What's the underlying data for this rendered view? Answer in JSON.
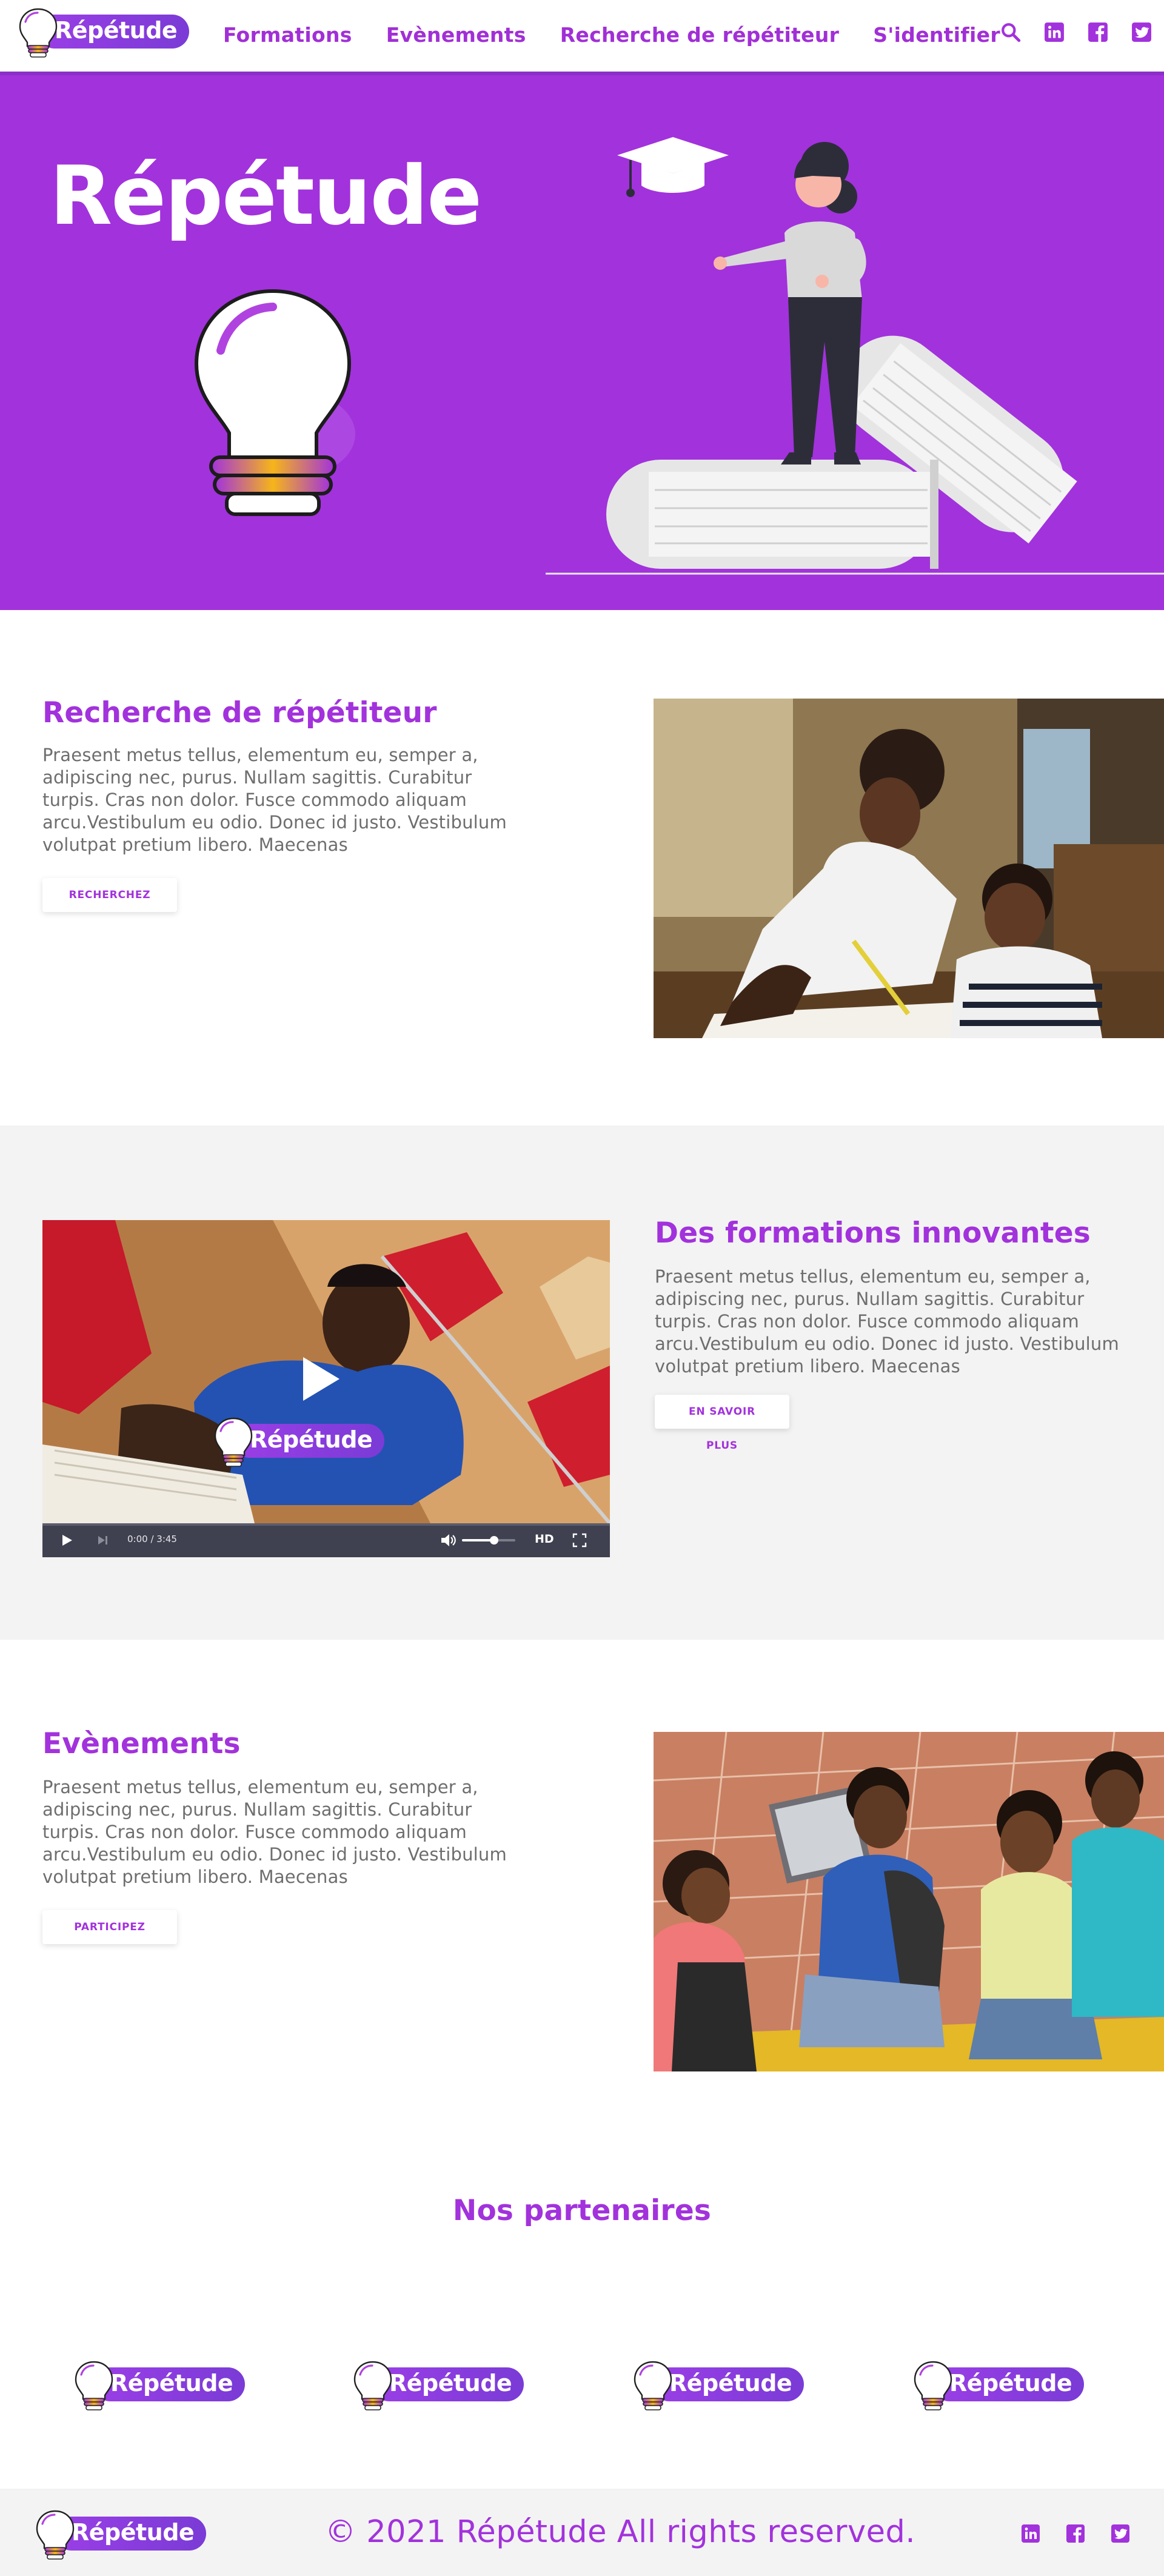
{
  "brand": {
    "name": "Répétude",
    "accent": "#a232dc"
  },
  "nav": {
    "links": [
      "Formations",
      "Evènements",
      "Recherche de répétiteur",
      "S'identifier"
    ],
    "icons": [
      "search-icon",
      "linkedin-icon",
      "facebook-icon",
      "twitter-icon"
    ]
  },
  "hero": {
    "title": "Répétude"
  },
  "sections": {
    "tutor": {
      "title": "Recherche de répétiteur",
      "text": "Praesent metus tellus, elementum eu, semper a, adipiscing nec, purus. Nullam sagittis. Curabitur turpis. Cras non dolor. Fusce commodo aliquam arcu.Vestibulum eu odio. Donec id justo. Vestibulum volutpat pretium libero. Maecenas",
      "button": "RECHERCHEZ"
    },
    "training": {
      "title": "Des formations innovantes",
      "text": "Praesent metus tellus, elementum eu, semper a, adipiscing nec, purus. Nullam sagittis. Curabitur turpis. Cras non dolor. Fusce commodo aliquam arcu.Vestibulum eu odio. Donec id justo. Vestibulum volutpat pretium libero. Maecenas",
      "button": "EN SAVOIR PLUS"
    },
    "events": {
      "title": "Evènements",
      "text": "Praesent metus tellus, elementum eu, semper a, adipiscing nec, purus. Nullam sagittis. Curabitur turpis. Cras non dolor. Fusce commodo aliquam arcu.Vestibulum eu odio. Donec id justo. Vestibulum volutpat pretium libero. Maecenas",
      "button": "PARTICIPEZ"
    },
    "partners": {
      "title": "Nos partenaires",
      "logos": [
        "Répétude",
        "Répétude",
        "Répétude",
        "Répétude"
      ]
    }
  },
  "video": {
    "time": "0:00 / 3:45",
    "quality": "HD",
    "progress": 0.0,
    "volume": 0.6,
    "watermark": "Répétude"
  },
  "footer": {
    "copyright": "© 2021 Répétude All rights reserved.",
    "icons": [
      "linkedin-icon",
      "facebook-icon",
      "twitter-icon"
    ]
  }
}
